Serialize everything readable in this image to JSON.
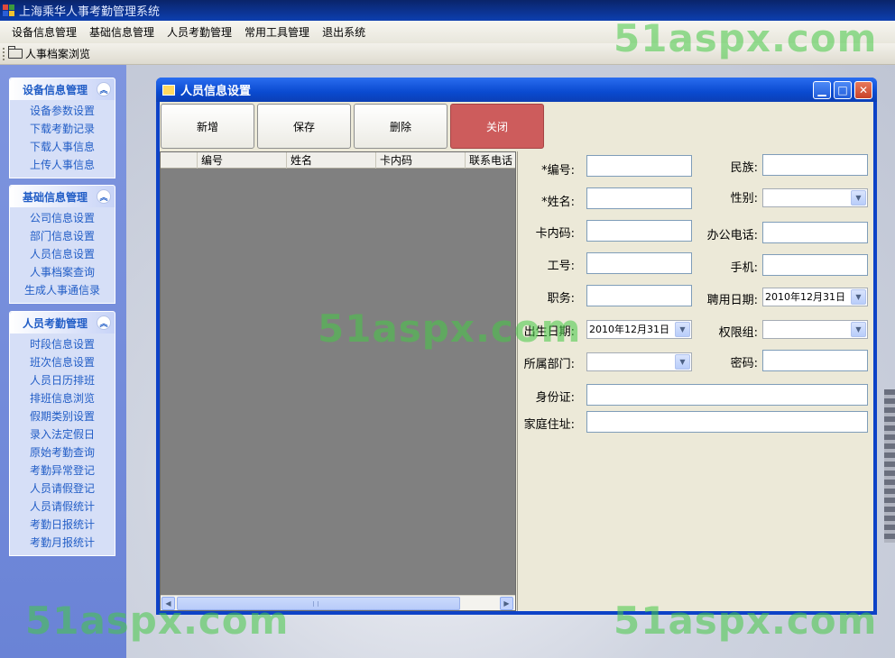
{
  "app": {
    "title": "上海乘华人事考勤管理系统"
  },
  "menu": [
    "设备信息管理",
    "基础信息管理",
    "人员考勤管理",
    "常用工具管理",
    "退出系统"
  ],
  "toolbar": {
    "browse_label": "人事档案浏览"
  },
  "sidebar": {
    "groups": [
      {
        "title": "设备信息管理",
        "items": [
          "设备参数设置",
          "下载考勤记录",
          "下载人事信息",
          "上传人事信息"
        ]
      },
      {
        "title": "基础信息管理",
        "items": [
          "公司信息设置",
          "部门信息设置",
          "人员信息设置",
          "人事档案查询",
          "生成人事通信录"
        ]
      },
      {
        "title": "人员考勤管理",
        "items": [
          "时段信息设置",
          "班次信息设置",
          "人员日历排班",
          "排班信息浏览",
          "假期类别设置",
          "录入法定假日",
          "原始考勤查询",
          "考勤异常登记",
          "人员请假登记",
          "人员请假统计",
          "考勤日报统计",
          "考勤月报统计"
        ]
      }
    ]
  },
  "window": {
    "title": "人员信息设置",
    "buttons": {
      "add": "新增",
      "save": "保存",
      "delete": "删除",
      "close": "关闭"
    },
    "grid": {
      "columns": [
        "",
        "编号",
        "姓名",
        "卡内码",
        "联系电话"
      ]
    },
    "form": {
      "id_label": "*编号:",
      "ethnicity_label": "民族:",
      "name_label": "*姓名:",
      "gender_label": "性别:",
      "card_label": "卡内码:",
      "office_phone_label": "办公电话:",
      "employee_no_label": "工号:",
      "mobile_label": "手机:",
      "position_label": "职务:",
      "hire_date_label": "聘用日期:",
      "hire_date_value": "2010年12月31日",
      "birth_date_label": "出生日期:",
      "birth_date_value": "2010年12月31日",
      "permission_label": "权限组:",
      "department_label": "所属部门:",
      "password_label": "密码:",
      "id_card_label": "身份证:",
      "address_label": "家庭住址:"
    }
  },
  "watermark": "51aspx.com",
  "colors": {
    "accent_close": "#cd5c5c",
    "sidebar_bg": "#7e95df",
    "title_bar": "#0d42c7"
  }
}
